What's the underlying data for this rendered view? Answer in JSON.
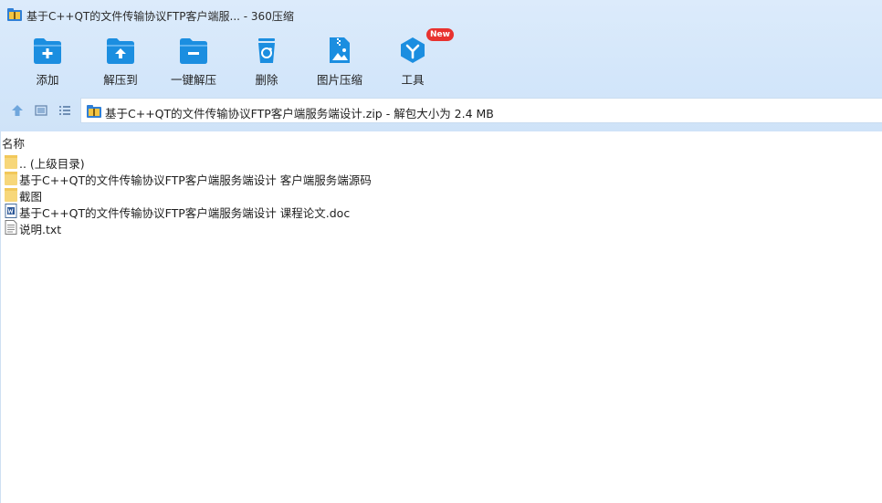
{
  "window": {
    "title": "基于C++QT的文件传输协议FTP客户端服... - 360压缩"
  },
  "toolbar": {
    "items": [
      {
        "label": "添加",
        "icon": "add-folder-icon"
      },
      {
        "label": "解压到",
        "icon": "extract-to-icon"
      },
      {
        "label": "一键解压",
        "icon": "one-click-extract-icon"
      },
      {
        "label": "删除",
        "icon": "recycle-bin-icon"
      },
      {
        "label": "图片压缩",
        "icon": "image-compress-icon"
      },
      {
        "label": "工具",
        "icon": "tools-icon",
        "badge": "New"
      }
    ]
  },
  "nav": {
    "up_icon": "up-arrow-icon",
    "view_icon": "thumbnail-view-icon",
    "list_icon": "list-view-icon",
    "path": "基于C++QT的文件传输协议FTP客户端服务端设计.zip - 解包大小为 2.4 MB"
  },
  "list": {
    "column_name": "名称",
    "rows": [
      {
        "name": ".. (上级目录)",
        "type": "folder"
      },
      {
        "name": "基于C++QT的文件传输协议FTP客户端服务端设计 客户端服务端源码",
        "type": "folder"
      },
      {
        "name": "截图",
        "type": "folder"
      },
      {
        "name": "基于C++QT的文件传输协议FTP客户端服务端设计 课程论文.doc",
        "type": "doc"
      },
      {
        "name": "说明.txt",
        "type": "txt"
      }
    ]
  },
  "colors": {
    "chrome_bg": "#d3e6fa",
    "accent_blue": "#1b8ee0",
    "folder_yellow": "#f7d77a",
    "badge_red": "#e8322f"
  }
}
